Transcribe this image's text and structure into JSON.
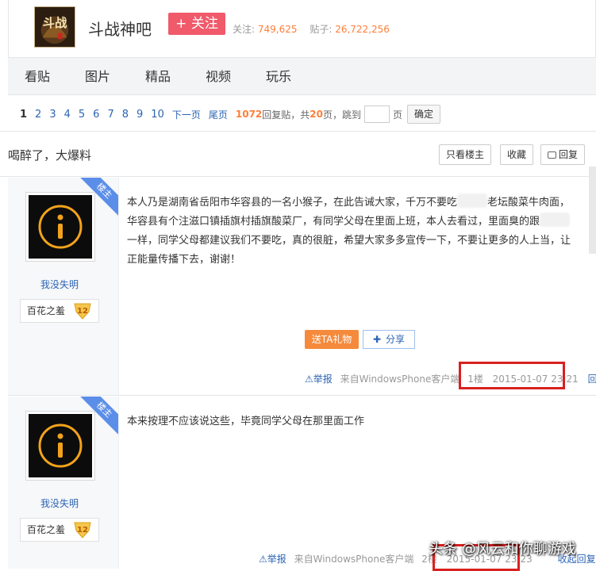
{
  "forum": {
    "name": "斗战神吧",
    "follow_label": "+ 关注",
    "follow_count_label": "关注:",
    "follow_count": "749,625",
    "post_count_label": "贴子:",
    "post_count": "26,722,256",
    "logo_text": "斗战"
  },
  "nav": {
    "tabs": [
      "看贴",
      "图片",
      "精品",
      "视频",
      "玩乐"
    ]
  },
  "pager": {
    "pages": [
      "1",
      "2",
      "3",
      "4",
      "5",
      "6",
      "7",
      "8",
      "9",
      "10"
    ],
    "next": "下一页",
    "last": "尾页",
    "reply_count": "1072",
    "reply_label": "回复贴，共",
    "total_pages": "20",
    "pages_label": "页，跳到",
    "page_suffix": "页",
    "confirm": "确定"
  },
  "thread": {
    "title": "喝醉了，大爆料",
    "only_op": "只看楼主",
    "favorite": "收藏",
    "reply": "回复"
  },
  "posts": [
    {
      "badge": "楼主",
      "username": "我没失明",
      "level_name": "百花之羞",
      "level": "12",
      "content_parts": [
        "本人乃是湖南省岳阳市华容县的一名小猴子，在此告诫大家，千万不要吃",
        "老坛酸菜牛肉面，华容县有个注滋口镇插旗村插旗酸菜厂，有同学父母在里面上班，本人去看过，里面臭的跟",
        "一样，同学父母都建议我们不要吃，真的很脏，希望大家多多宣传一下，不要让更多的人上当，让正能量传播下去，谢谢！"
      ],
      "gift": "送TA礼物",
      "share": "分享",
      "report": "举报",
      "client": "来自WindowsPhone客户端",
      "floor": "1楼",
      "time": "2015-01-07 23:21",
      "reply": "回复"
    },
    {
      "badge": "楼主",
      "username": "我没失明",
      "level_name": "百花之羞",
      "level": "12",
      "content": "本来按理不应该说这些，毕竟同学父母在那里面工作",
      "report": "举报",
      "client": "来自WindowsPhone客户端",
      "floor": "2楼",
      "time": "2015-01-07 23:23",
      "reply": "收起回复"
    }
  ],
  "watermark": "头条 @风云和你聊游戏",
  "colors": {
    "accent": "#2d64b3",
    "follow": "#f05a6b",
    "highlight": "#ff7e3a",
    "badge": "#5b8ee8",
    "marker": "#d9211f"
  }
}
